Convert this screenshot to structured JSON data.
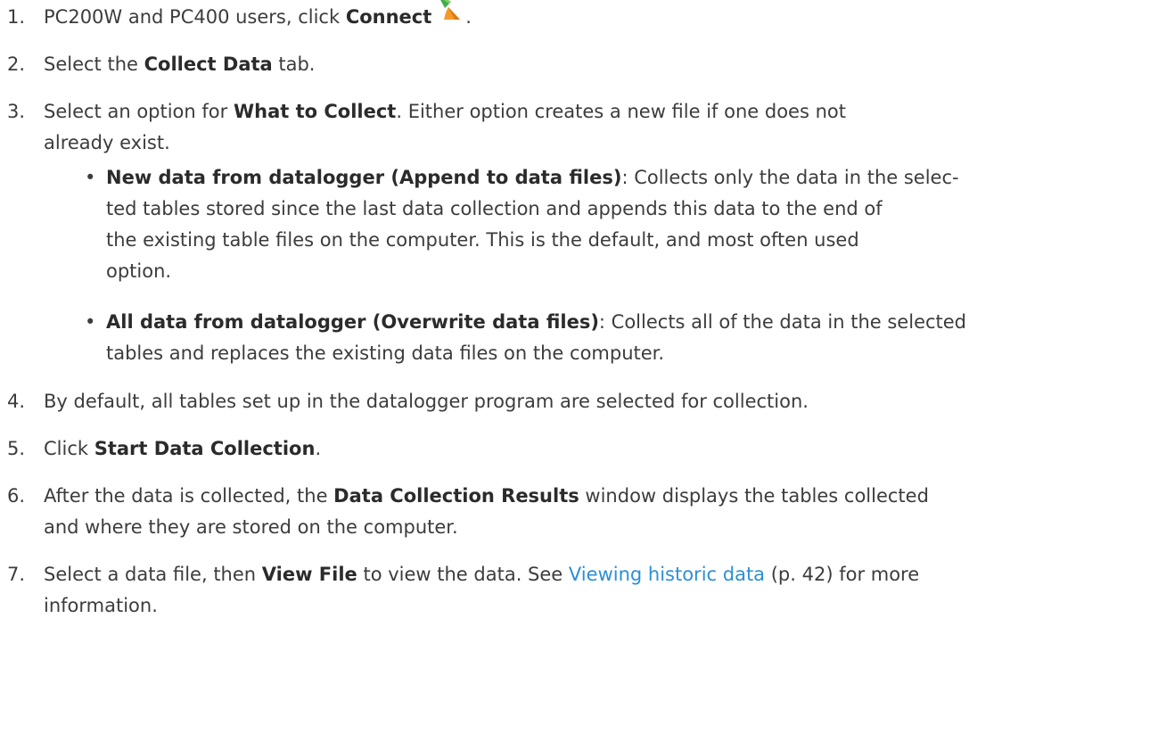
{
  "steps": [
    {
      "num": "1.",
      "pre": "PC200W and PC400 users, click ",
      "bold": "Connect",
      "post": "."
    },
    {
      "num": "2.",
      "pre": "Select the ",
      "bold": "Collect Data",
      "post": " tab."
    },
    {
      "num": "3.",
      "pre": "Select an option for ",
      "bold": "What to Collect",
      "post_line1": ". Either option creates a new file if one does not",
      "post_line2": "already exist."
    },
    {
      "num": "4.",
      "text": "By default, all tables set up in the datalogger program are selected for collection."
    },
    {
      "num": "5.",
      "pre": "Click ",
      "bold": "Start Data Collection",
      "post": "."
    },
    {
      "num": "6.",
      "pre": "After the data is collected, the ",
      "bold": "Data Collection Results",
      "post_line1": " window displays the tables collected",
      "post_line2": "and where they are stored on the computer."
    },
    {
      "num": "7.",
      "pre": "Select a data file, then ",
      "bold": "View File",
      "mid": " to view the data. See ",
      "link": "Viewing historic data",
      "post_line1": " (p. 42) for more",
      "post_line2": "information."
    }
  ],
  "options": [
    {
      "bold": "New data from datalogger (Append to data files)",
      "lines": [
        ": Collects only the data in the selec-",
        "ted tables stored since the last data collection and appends this data to the end of",
        "the existing table files on the computer. This is the default, and most often used",
        "option."
      ]
    },
    {
      "bold": "All data from datalogger (Overwrite data files)",
      "lines": [
        ": Collects all of the data in the selected",
        "tables and replaces the existing data files on the computer."
      ]
    }
  ],
  "bullet_glyph": "•",
  "icon": {
    "name": "connect-icon",
    "colors": {
      "green": "#3fae49",
      "orange": "#f39a2b"
    }
  },
  "link_color": "#2b8fd6"
}
